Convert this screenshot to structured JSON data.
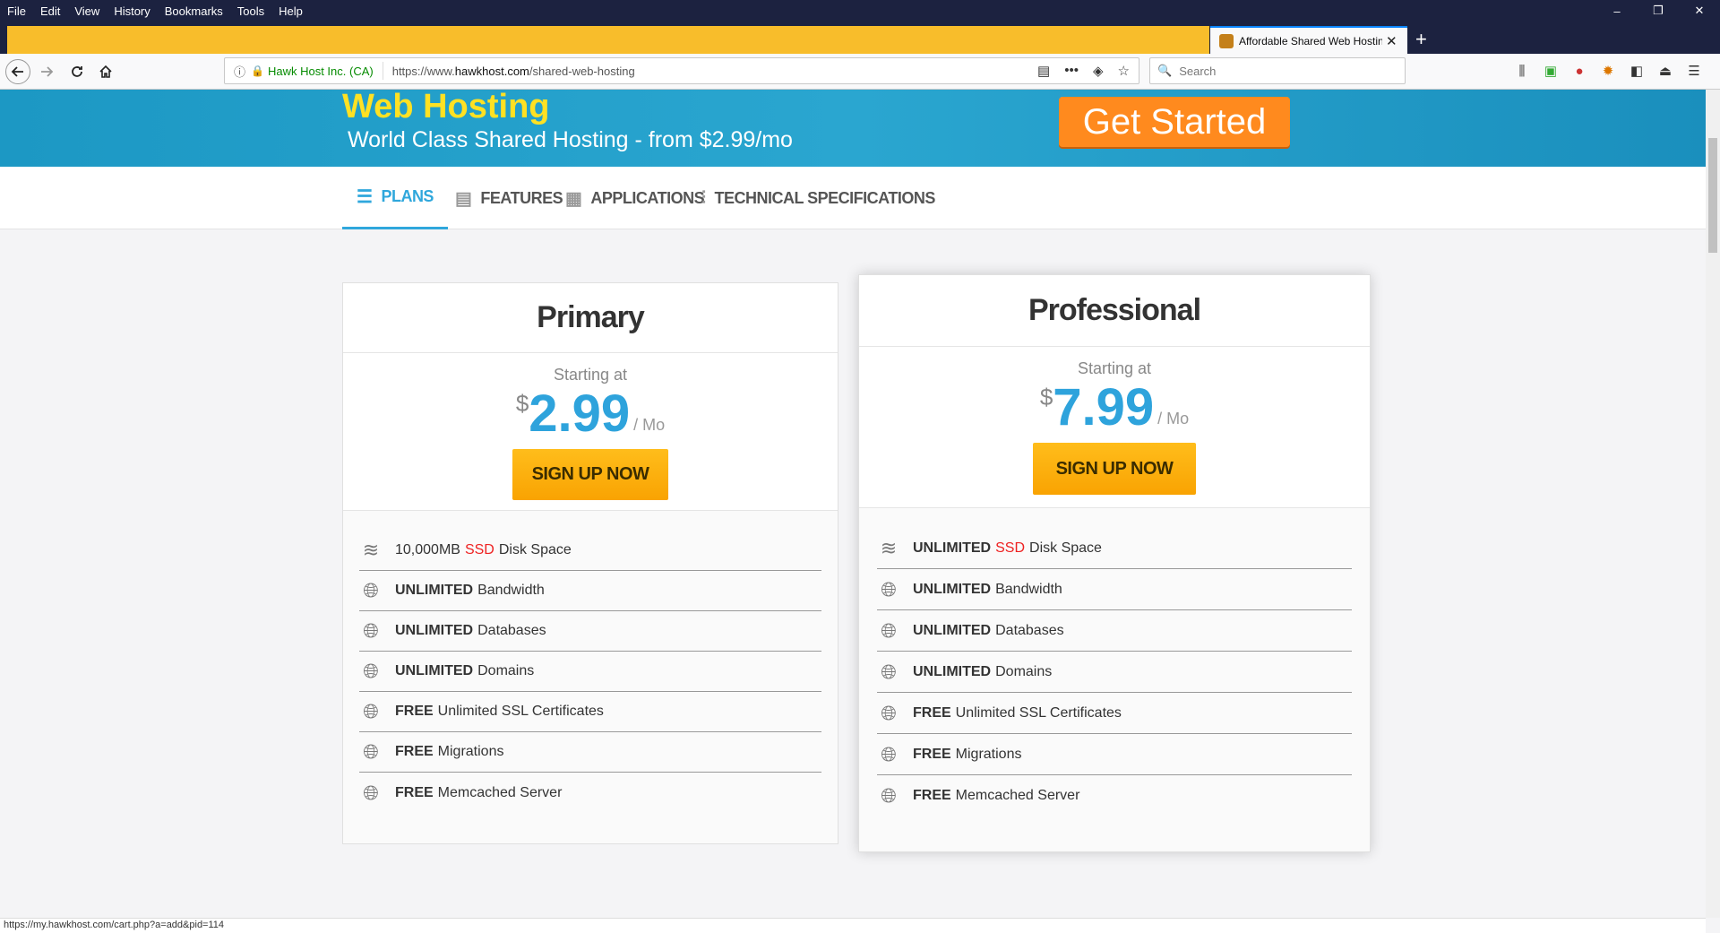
{
  "menu": [
    "File",
    "Edit",
    "View",
    "History",
    "Bookmarks",
    "Tools",
    "Help"
  ],
  "window_controls": {
    "minimize": "–",
    "restore": "❐",
    "close": "✕"
  },
  "tab": {
    "title": "Affordable Shared Web Hosting",
    "close": "✕",
    "new": "+"
  },
  "urlbar": {
    "org": "Hawk Host Inc. (CA)",
    "url_prefix": "https://www.",
    "url_domain": "hawkhost.com",
    "url_path": "/shared-web-hosting"
  },
  "search": {
    "placeholder": "Search"
  },
  "hero": {
    "title": "Web Hosting",
    "subtitle": "World Class Shared Hosting - from $2.99/mo",
    "cta": "Get Started"
  },
  "subnav": [
    {
      "label": "PLANS",
      "icon": "list-icon",
      "active": true
    },
    {
      "label": "FEATURES",
      "icon": "features-icon",
      "active": false
    },
    {
      "label": "APPLICATIONS",
      "icon": "grid-icon",
      "active": false
    },
    {
      "label": "TECHNICAL SPECIFICATIONS",
      "icon": "sliders-icon",
      "active": false
    }
  ],
  "plans": [
    {
      "name": "Primary",
      "starting": "Starting at",
      "currency": "$",
      "price": "2.99",
      "per": "/ Mo",
      "cta": "SIGN UP NOW",
      "features": [
        {
          "bold": "",
          "pre": "10,000MB",
          "ssd": "SSD",
          "text": "Disk Space",
          "icon": "layers-icon"
        },
        {
          "bold": "UNLIMITED",
          "text": "Bandwidth",
          "icon": "globe-icon"
        },
        {
          "bold": "UNLIMITED",
          "text": "Databases",
          "icon": "globe-icon"
        },
        {
          "bold": "UNLIMITED",
          "text": "Domains",
          "icon": "globe-icon"
        },
        {
          "bold": "FREE",
          "text": "Unlimited SSL Certificates",
          "icon": "globe-icon"
        },
        {
          "bold": "FREE",
          "text": "Migrations",
          "icon": "globe-icon"
        },
        {
          "bold": "FREE",
          "text": "Memcached Server",
          "icon": "globe-icon"
        }
      ]
    },
    {
      "name": "Professional",
      "starting": "Starting at",
      "currency": "$",
      "price": "7.99",
      "per": "/ Mo",
      "cta": "SIGN UP NOW",
      "features": [
        {
          "bold": "UNLIMITED",
          "ssd": "SSD",
          "text": "Disk Space",
          "icon": "layers-icon"
        },
        {
          "bold": "UNLIMITED",
          "text": "Bandwidth",
          "icon": "globe-icon"
        },
        {
          "bold": "UNLIMITED",
          "text": "Databases",
          "icon": "globe-icon"
        },
        {
          "bold": "UNLIMITED",
          "text": "Domains",
          "icon": "globe-icon"
        },
        {
          "bold": "FREE",
          "text": "Unlimited SSL Certificates",
          "icon": "globe-icon"
        },
        {
          "bold": "FREE",
          "text": "Migrations",
          "icon": "globe-icon"
        },
        {
          "bold": "FREE",
          "text": "Memcached Server",
          "icon": "globe-icon"
        }
      ]
    }
  ],
  "status": "https://my.hawkhost.com/cart.php?a=add&pid=114"
}
